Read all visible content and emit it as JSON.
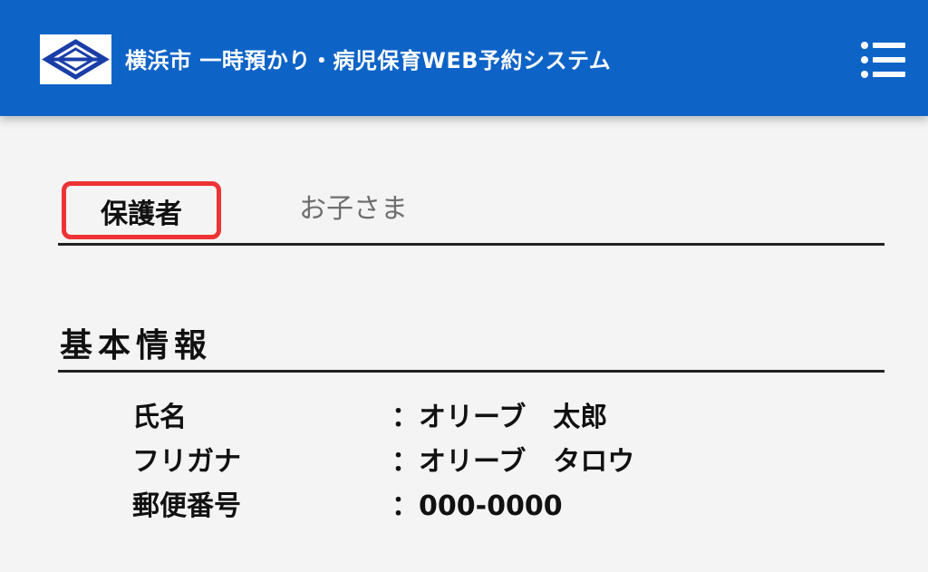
{
  "header": {
    "title": "横浜市 一時預かり・病児保育WEB予約システム",
    "bg_color": "#0e63c7",
    "logo_icon": "yokohama-city-emblem",
    "menu_icon": "list-menu-icon"
  },
  "tabs": [
    {
      "label": "保護者",
      "selected": true
    },
    {
      "label": "お子さま",
      "selected": false
    }
  ],
  "highlight_color": "#ee3333",
  "section": {
    "title": "基本情報",
    "rows": [
      {
        "label": "氏名",
        "value": "：オリーブ　太郎"
      },
      {
        "label": "フリガナ",
        "value": "：オリーブ　タロウ"
      },
      {
        "label": "郵便番号",
        "value": "：000-0000"
      }
    ]
  }
}
